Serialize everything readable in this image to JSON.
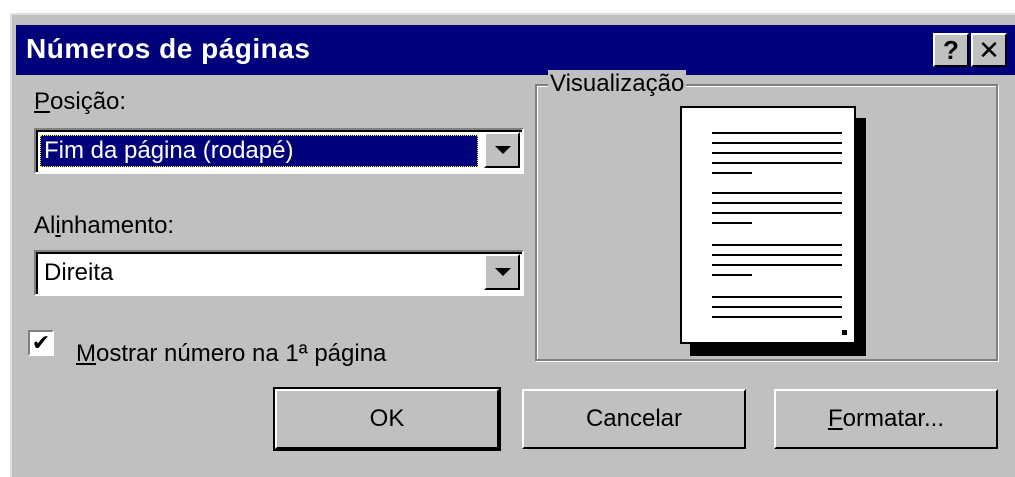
{
  "window": {
    "title": "Números de páginas"
  },
  "titlebar": {
    "help_label": "?",
    "close_label": "✕"
  },
  "position": {
    "label_first": "P",
    "label_rest": "osição:",
    "value": "Fim da página (rodapé)"
  },
  "alignment": {
    "label_pre": "Al",
    "label_u": "i",
    "label_post": "nhamento:",
    "value": "Direita"
  },
  "show_first": {
    "checked": true,
    "check_glyph": "✔",
    "label_first": "M",
    "label_rest": "ostrar número na 1ª página"
  },
  "preview": {
    "group_label": "Visualização"
  },
  "buttons": {
    "ok": "OK",
    "cancel": "Cancelar",
    "format_first": "F",
    "format_rest": "ormatar..."
  },
  "colors": {
    "titlebar": "#00007b",
    "face": "#c0c0c0"
  },
  "icons": {
    "dropdown": "chevron-down-icon",
    "check": "checkmark-icon"
  }
}
